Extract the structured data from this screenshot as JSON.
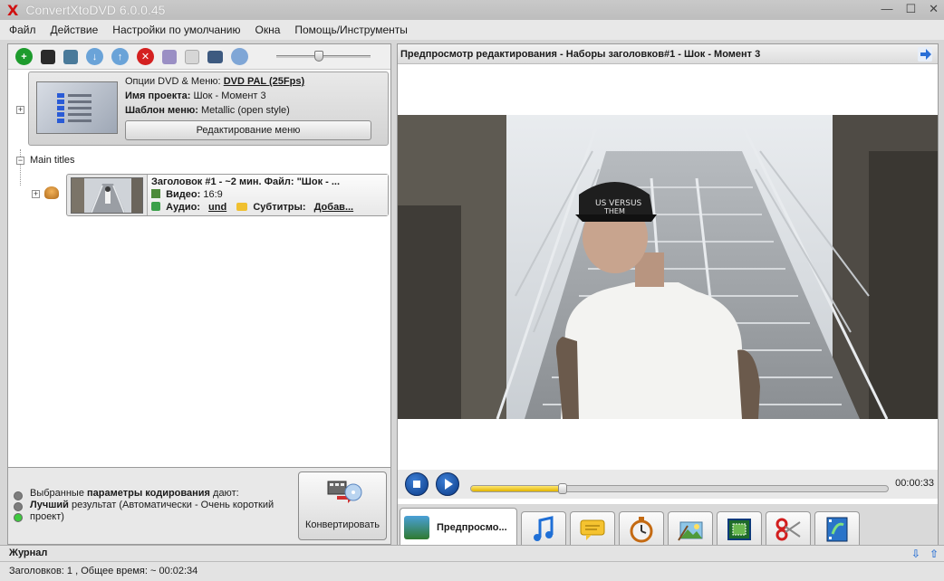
{
  "app": {
    "title": "ConvertXtoDVD 6.0.0.45"
  },
  "menu": [
    "Файл",
    "Действие",
    "Настройки по умолчанию",
    "Окна",
    "Помощь/Инструменты"
  ],
  "toolbar": {
    "icons": [
      "add-icon",
      "save-icon",
      "film-icon",
      "move-down-icon",
      "move-up-icon",
      "remove-icon",
      "tools-icon",
      "page-icon",
      "monitor-icon",
      "disc-icon"
    ],
    "zoom": 0.45
  },
  "project": {
    "dvd_options_label": "Опции DVD & Меню:",
    "dvd_options_value": "DVD PAL (25Fps)",
    "name_label": "Имя проекта:",
    "name_value": "Шок - Момент 3",
    "template_label": "Шаблон меню:",
    "template_value": "Metallic (open style)",
    "edit_menu_button": "Редактирование меню"
  },
  "tree": {
    "main_titles": "Main titles"
  },
  "title_item": {
    "heading": "Заголовок #1 - ~2 мин. Файл: \"Шок - ...",
    "video_label": "Видео:",
    "video_value": "16:9",
    "audio_label": "Аудио:",
    "audio_value": "und",
    "subs_label": "Субтитры:",
    "subs_value": "Добав..."
  },
  "encoding": {
    "line_pre": "Выбранные ",
    "line_bold": "параметры кодирования",
    "line_post": " дают:",
    "result_bold": "Лучший",
    "result_rest": " результат (Автоматически - Очень короткий проект)"
  },
  "convert_button": "Конвертировать",
  "preview": {
    "header": "Предпросмотр редактирования - Наборы заголовков#1 - Шок - Момент 3",
    "time": "00:00:33",
    "progress": 0.22,
    "active_tab": "Предпросмо...",
    "tabs": [
      "music-icon",
      "subtitle-icon",
      "chapters-icon",
      "image-edit-icon",
      "crop-icon",
      "cut-icon",
      "merge-icon"
    ]
  },
  "log": {
    "title": "Журнал"
  },
  "status": {
    "text": "Заголовков: 1 , Общее время: ~ 00:02:34"
  },
  "colors": {
    "accent": "#2a6fd6",
    "danger": "#d42020",
    "seek": "#f0c800"
  }
}
